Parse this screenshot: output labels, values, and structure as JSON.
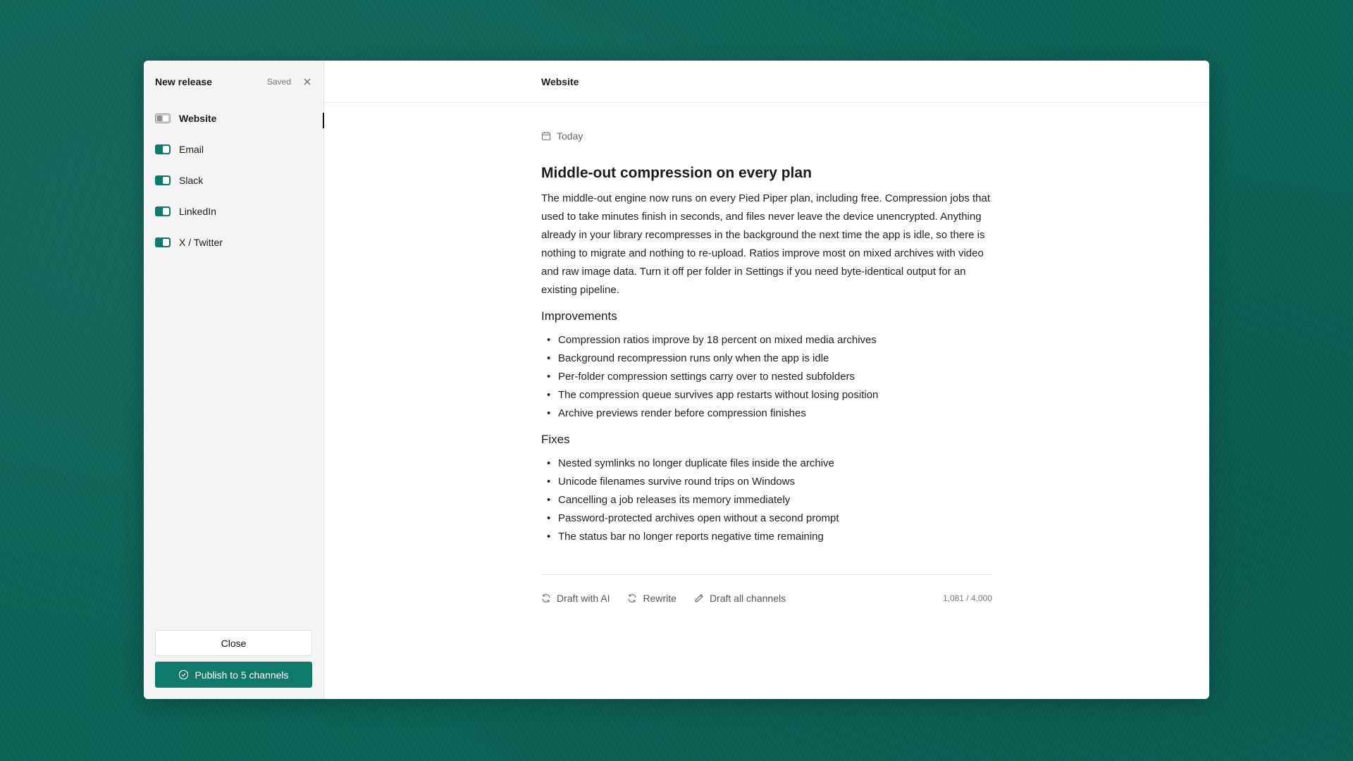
{
  "sidebar": {
    "title": "New release",
    "saved": "Saved",
    "channels": [
      {
        "label": "Website",
        "enabled": false,
        "active": true
      },
      {
        "label": "Email",
        "enabled": true,
        "active": false
      },
      {
        "label": "Slack",
        "enabled": true,
        "active": false
      },
      {
        "label": "LinkedIn",
        "enabled": true,
        "active": false
      },
      {
        "label": "X / Twitter",
        "enabled": true,
        "active": false
      }
    ],
    "close_label": "Close",
    "publish_label": "Publish to 5 channels"
  },
  "main": {
    "title": "Website",
    "date": "Today",
    "post_title": "Middle-out compression on every plan",
    "body": "The middle-out engine now runs on every Pied Piper plan, including free. Compression jobs that used to take minutes finish in seconds, and files never leave the device unencrypted. Anything already in your library recompresses in the background the next time the app is idle, so there is nothing to migrate and nothing to re-upload. Ratios improve most on mixed archives with video and raw image data. Turn it off per folder in Settings if you need byte-identical output for an existing pipeline.",
    "sections": [
      {
        "heading": "Improvements",
        "items": [
          "Compression ratios improve by 18 percent on mixed media archives",
          "Background recompression runs only when the app is idle",
          "Per-folder compression settings carry over to nested subfolders",
          "The compression queue survives app restarts without losing position",
          "Archive previews render before compression finishes"
        ]
      },
      {
        "heading": "Fixes",
        "items": [
          "Nested symlinks no longer duplicate files inside the archive",
          "Unicode filenames survive round trips on Windows",
          "Cancelling a job releases its memory immediately",
          "Password-protected archives open without a second prompt",
          "The status bar no longer reports negative time remaining"
        ]
      }
    ],
    "toolbar": {
      "draft_ai": "Draft with AI",
      "rewrite": "Rewrite",
      "draft_all": "Draft all channels",
      "counter": "1,081 / 4,000"
    }
  },
  "icons": {
    "close": "close-icon",
    "calendar": "calendar-icon",
    "refresh": "refresh-icon",
    "pencil": "pencil-icon",
    "check_circle": "check-circle-icon"
  },
  "colors": {
    "accent": "#0f7a6c",
    "background": "#0c6256"
  }
}
